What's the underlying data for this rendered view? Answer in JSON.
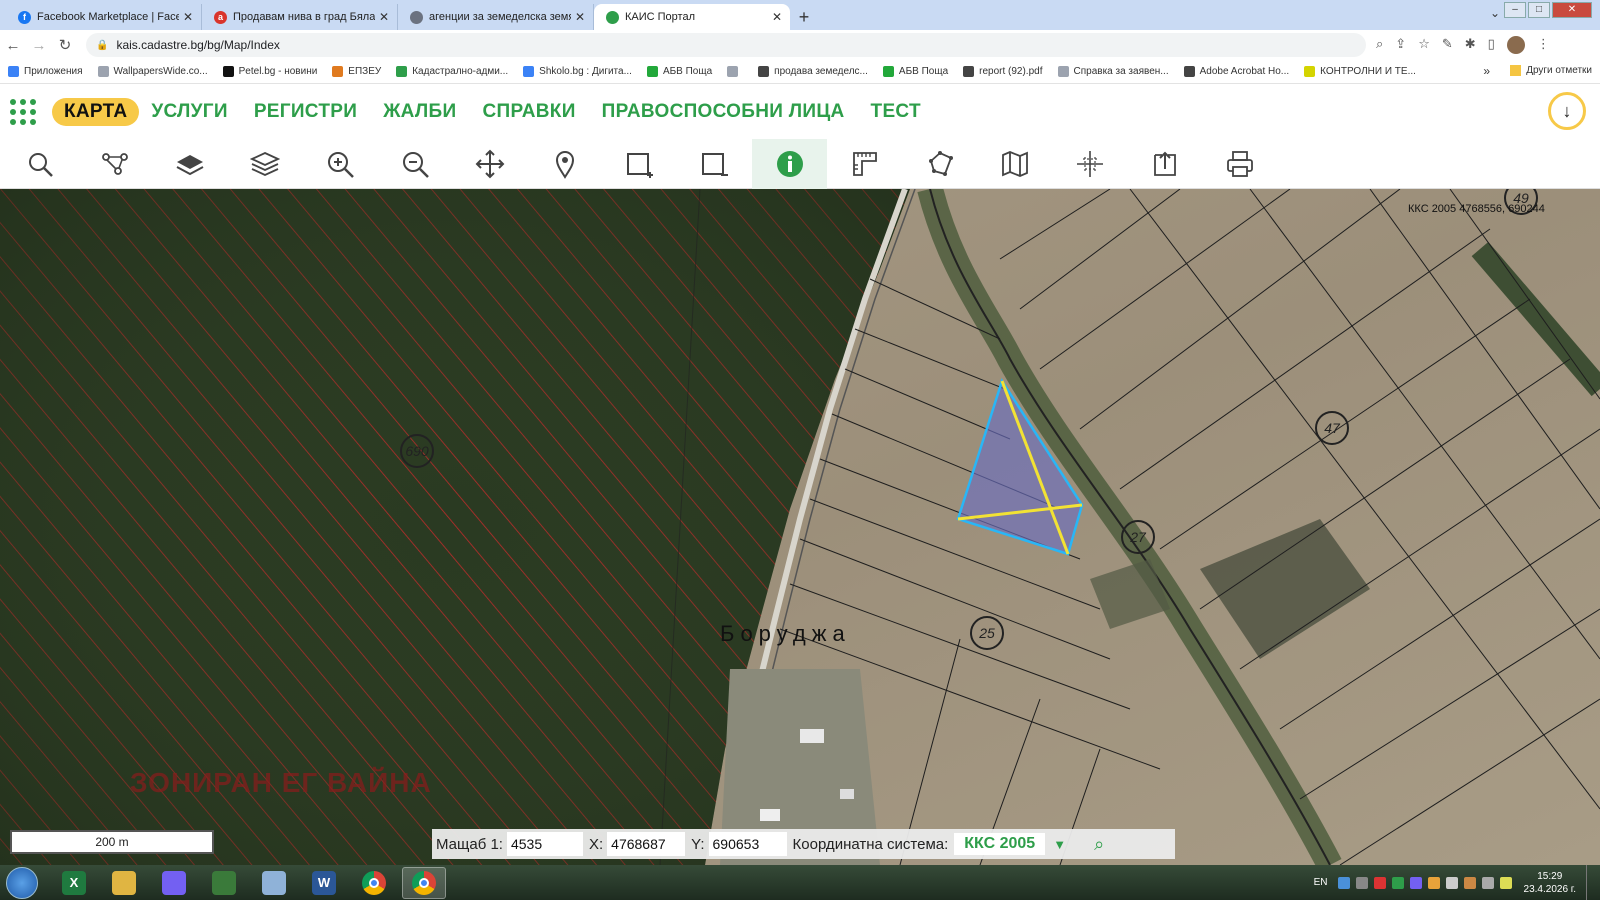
{
  "browser": {
    "tabs": [
      {
        "title": "Facebook Marketplace | Facebook",
        "color": "#1877f2",
        "glyph": "f",
        "active": false
      },
      {
        "title": "Продавам нива в град Бяла, об...",
        "color": "#d9342b",
        "glyph": "a",
        "active": false
      },
      {
        "title": "агенции за земеделска земя",
        "color": "#6b7280",
        "glyph": "",
        "active": false
      },
      {
        "title": "КАИС Портал",
        "color": "#2e9e4a",
        "glyph": "",
        "active": true
      }
    ],
    "url": "kais.cadastre.bg/bg/Map/Index",
    "bookmarks": [
      {
        "label": "Приложения",
        "color": "#3b82f6"
      },
      {
        "label": "WallpapersWide.co...",
        "color": "#9ca3af"
      },
      {
        "label": "Petel.bg - новини",
        "color": "#111111"
      },
      {
        "label": "ЕПЗЕУ",
        "color": "#e07a1f"
      },
      {
        "label": "Кадастрално-адми...",
        "color": "#2e9e4a"
      },
      {
        "label": "Shkolo.bg : Дигита...",
        "color": "#3b82f6"
      },
      {
        "label": "АБВ Поща",
        "color": "#22a83a"
      },
      {
        "label": "",
        "color": "#9ca3af"
      },
      {
        "label": "продава земеделс...",
        "color": "#444444"
      },
      {
        "label": "АБВ Поща",
        "color": "#22a83a"
      },
      {
        "label": "report (92).pdf",
        "color": "#444444"
      },
      {
        "label": "Справка за заявен...",
        "color": "#9ca3af"
      },
      {
        "label": "Adobe Acrobat Ho...",
        "color": "#444444"
      },
      {
        "label": "КОНТРОЛНИ И ТЕ...",
        "color": "#d4d400"
      }
    ],
    "bookmarks_more": "»",
    "bookmarks_other": "Други отметки"
  },
  "app": {
    "menu": [
      {
        "label": "КАРТА",
        "active": true
      },
      {
        "label": "УСЛУГИ",
        "active": false
      },
      {
        "label": "РЕГИСТРИ",
        "active": false
      },
      {
        "label": "ЖАЛБИ",
        "active": false
      },
      {
        "label": "СПРАВКИ",
        "active": false
      },
      {
        "label": "ПРАВОСПОСОБНИ ЛИЦА",
        "active": false
      },
      {
        "label": "ТЕСТ",
        "active": false
      }
    ],
    "download_glyph": "↓",
    "tools": [
      {
        "name": "search-tool",
        "icon": "search-icon"
      },
      {
        "name": "network-tool",
        "icon": "nodes-icon"
      },
      {
        "name": "layer-tool",
        "icon": "layer-icon"
      },
      {
        "name": "layers-tool",
        "icon": "layers-icon"
      },
      {
        "name": "zoom-in-tool",
        "icon": "zoom-in-icon"
      },
      {
        "name": "zoom-out-tool",
        "icon": "zoom-out-icon"
      },
      {
        "name": "pan-tool",
        "icon": "move-icon"
      },
      {
        "name": "marker-tool",
        "icon": "marker-icon"
      },
      {
        "name": "zoom-box-in-tool",
        "icon": "box-plus-icon"
      },
      {
        "name": "zoom-box-out-tool",
        "icon": "box-minus-icon"
      },
      {
        "name": "info-tool",
        "icon": "info-icon",
        "active": true
      },
      {
        "name": "measure-tool",
        "icon": "ruler-icon"
      },
      {
        "name": "polygon-tool",
        "icon": "polygon-icon"
      },
      {
        "name": "map-tool",
        "icon": "map-icon"
      },
      {
        "name": "coordinates-tool",
        "icon": "crosshair-icon"
      },
      {
        "name": "export-tool",
        "icon": "export-icon"
      },
      {
        "name": "print-tool",
        "icon": "print-icon"
      }
    ]
  },
  "map": {
    "coord_readout": "ККС 2005 4768556, 690244",
    "parcel_labels": [
      "690",
      "47",
      "27",
      "25",
      "49"
    ],
    "place_name": "Боруджа",
    "watermark_text": "ЗОНИРАН ЕГ ВАЙНА",
    "scale_label": "200 m"
  },
  "coordbar": {
    "scale_label": "Мащаб 1:",
    "scale_value": "4535",
    "x_label": "X:",
    "x_value": "4768687",
    "y_label": "Y:",
    "y_value": "690653",
    "system_label": "Координатна система:",
    "system_value": "ККС 2005"
  },
  "taskbar": {
    "apps": [
      {
        "name": "excel",
        "color": "#1f7a3f",
        "glyph": "X"
      },
      {
        "name": "explorer",
        "color": "#e0b542",
        "glyph": ""
      },
      {
        "name": "viber",
        "color": "#7360f2",
        "glyph": ""
      },
      {
        "name": "calculator",
        "color": "#3a7a3a",
        "glyph": ""
      },
      {
        "name": "paint",
        "color": "#8fb2d8",
        "glyph": ""
      },
      {
        "name": "word",
        "color": "#2b5797",
        "glyph": "W"
      },
      {
        "name": "chrome",
        "color": "#db4437",
        "glyph": ""
      },
      {
        "name": "chrome-active",
        "color": "#db4437",
        "glyph": ""
      }
    ],
    "lang": "EN",
    "time": "15:29",
    "date": "23.4.2026 г."
  }
}
